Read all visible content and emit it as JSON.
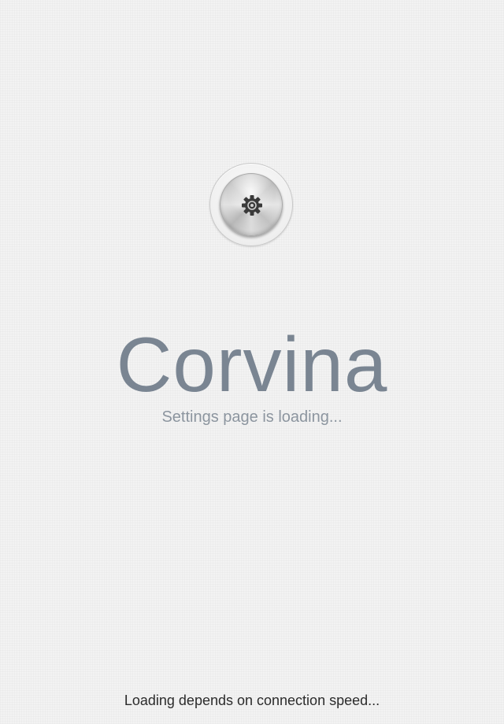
{
  "splash": {
    "settings_icon": "gear-icon",
    "app_name": "Corvina",
    "status_text": "Settings page is loading...",
    "footer_note": "Loading depends on connection speed..."
  },
  "colors": {
    "background": "#f3f3f3",
    "title": "#7a8592",
    "subtitle": "#8c959f",
    "footer": "#2b2b2b",
    "gear": "#3a3a3a"
  }
}
